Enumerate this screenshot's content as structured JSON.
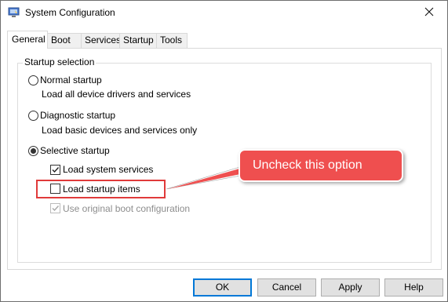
{
  "window": {
    "title": "System Configuration",
    "icon": "msconfig-icon",
    "close_glyph": "✕"
  },
  "tabs": [
    {
      "label": "General",
      "active": true
    },
    {
      "label": "Boot",
      "active": false
    },
    {
      "label": "Services",
      "active": false
    },
    {
      "label": "Startup",
      "active": false
    },
    {
      "label": "Tools",
      "active": false
    }
  ],
  "startup_selection": {
    "legend": "Startup selection",
    "normal": {
      "label": "Normal startup",
      "description": "Load all device drivers and services",
      "selected": false
    },
    "diagnostic": {
      "label": "Diagnostic startup",
      "description": "Load basic devices and services only",
      "selected": false
    },
    "selective": {
      "label": "Selective startup",
      "selected": true
    },
    "options": {
      "load_system_services": {
        "label": "Load system services",
        "checked": true,
        "enabled": true
      },
      "load_startup_items": {
        "label": "Load startup items",
        "checked": false,
        "enabled": true
      },
      "use_original_boot": {
        "label": "Use original boot configuration",
        "checked": true,
        "enabled": false
      }
    }
  },
  "annotation": {
    "callout_text": "Uncheck this option",
    "color": "#ef4f4f"
  },
  "buttons": {
    "ok": "OK",
    "cancel": "Cancel",
    "apply": "Apply",
    "help": "Help"
  },
  "colors": {
    "accent": "#0078d7",
    "highlight": "#e03a3a"
  }
}
